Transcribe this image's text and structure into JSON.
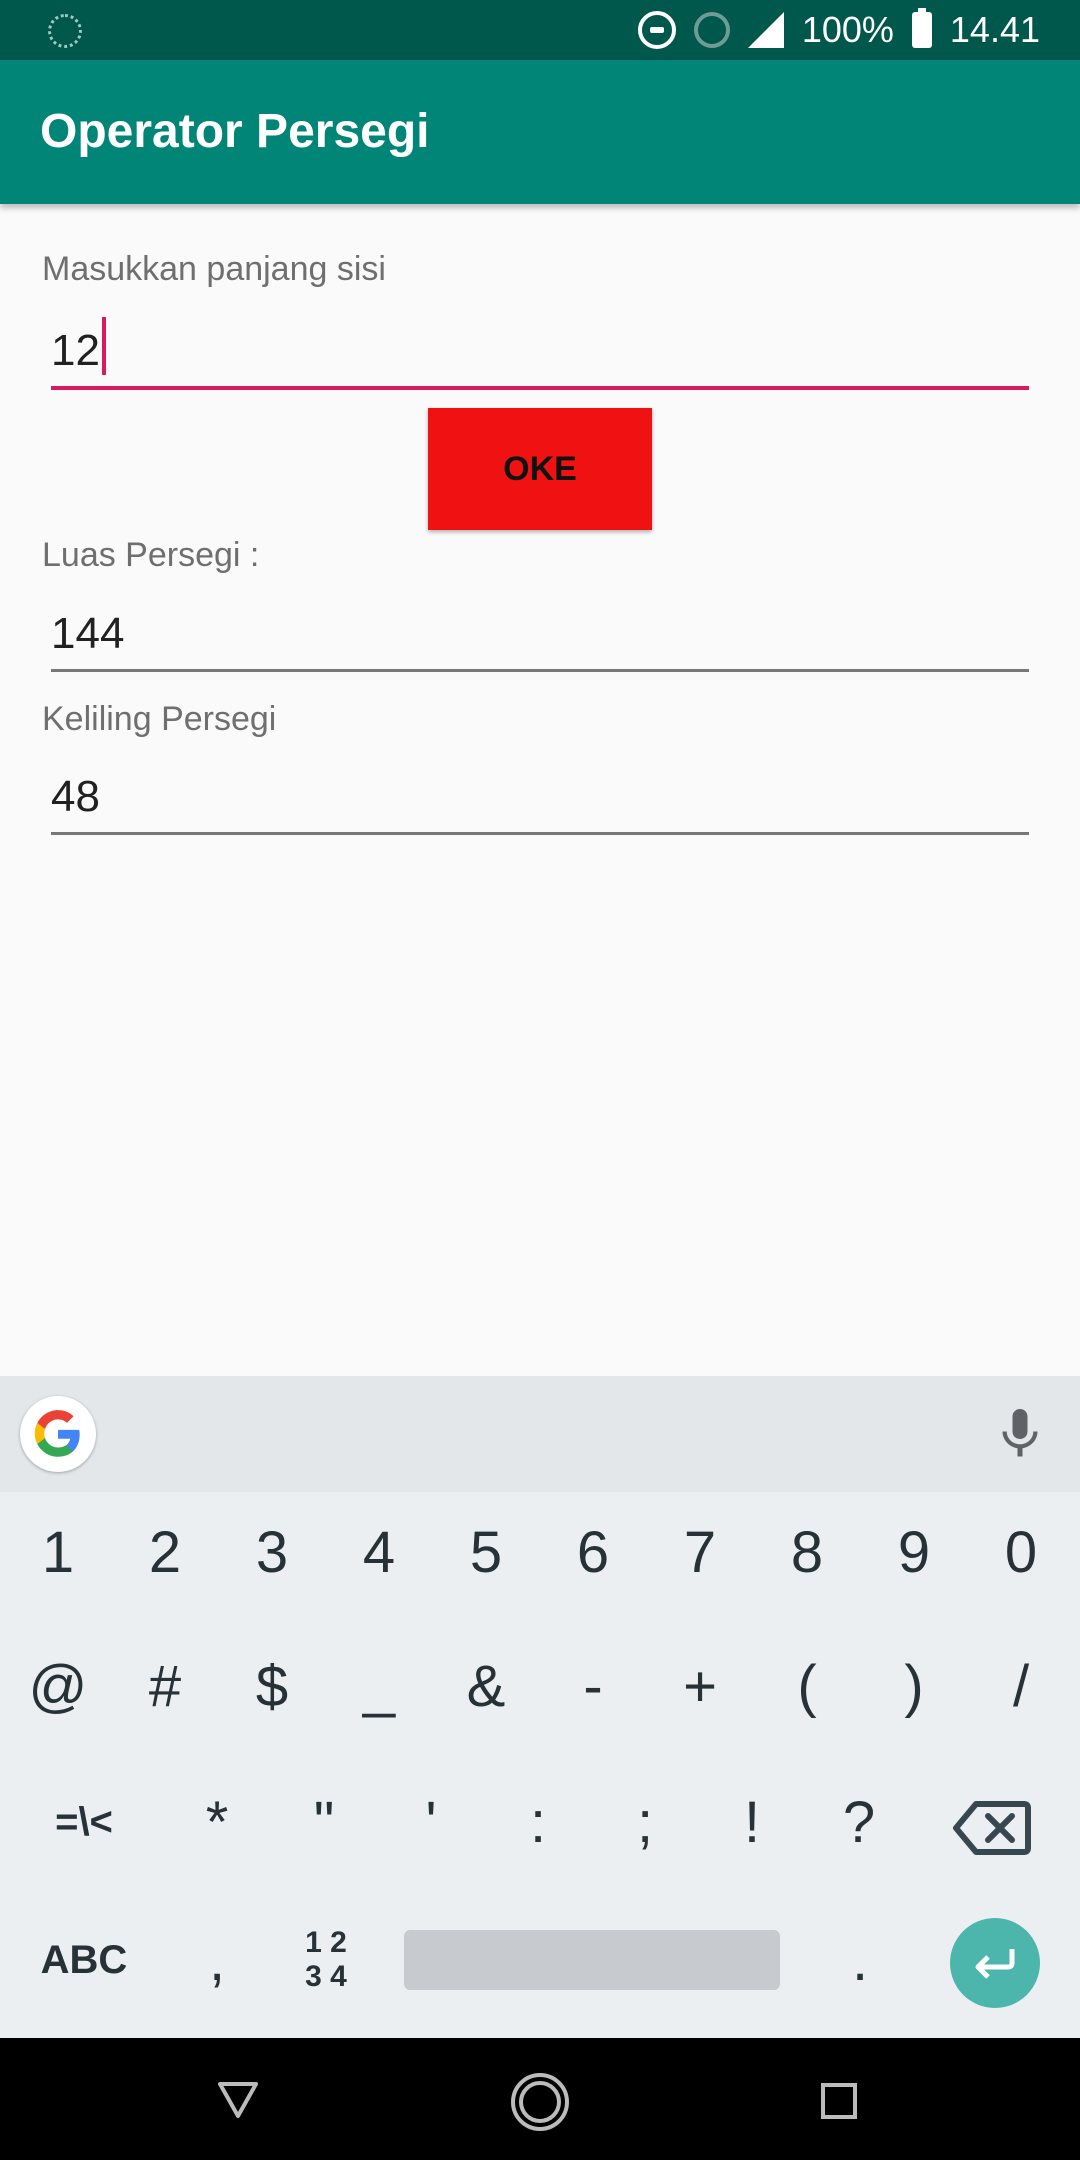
{
  "status_bar": {
    "battery": "100%",
    "time": "14.41",
    "icons": [
      "loading-icon",
      "do-not-disturb-icon",
      "alarm-icon",
      "signal-icon",
      "battery-icon"
    ]
  },
  "app_bar": {
    "title": "Operator Persegi"
  },
  "form": {
    "side_label": "Masukkan panjang sisi",
    "side_value": "12",
    "ok_button": "OKE",
    "area_label": "Luas Persegi :",
    "area_value": "144",
    "perimeter_label": "Keliling Persegi",
    "perimeter_value": "48"
  },
  "keyboard": {
    "row1": [
      "1",
      "2",
      "3",
      "4",
      "5",
      "6",
      "7",
      "8",
      "9",
      "0"
    ],
    "row2": [
      "@",
      "#",
      "$",
      "_",
      "&",
      "-",
      "+",
      "(",
      ")",
      "/"
    ],
    "row3": [
      "=\\<",
      "*",
      "\"",
      "'",
      ":",
      ";",
      "!",
      "?"
    ],
    "row4_abc": "ABC",
    "row4_comma": ",",
    "row4_num_top": "1 2",
    "row4_num_bottom": "3 4",
    "row4_period": "."
  },
  "colors": {
    "status_bar": "#00574b",
    "app_bar": "#008577",
    "accent": "#d81b60",
    "ok_button": "#f01212",
    "enter_key": "#4db6ac"
  }
}
